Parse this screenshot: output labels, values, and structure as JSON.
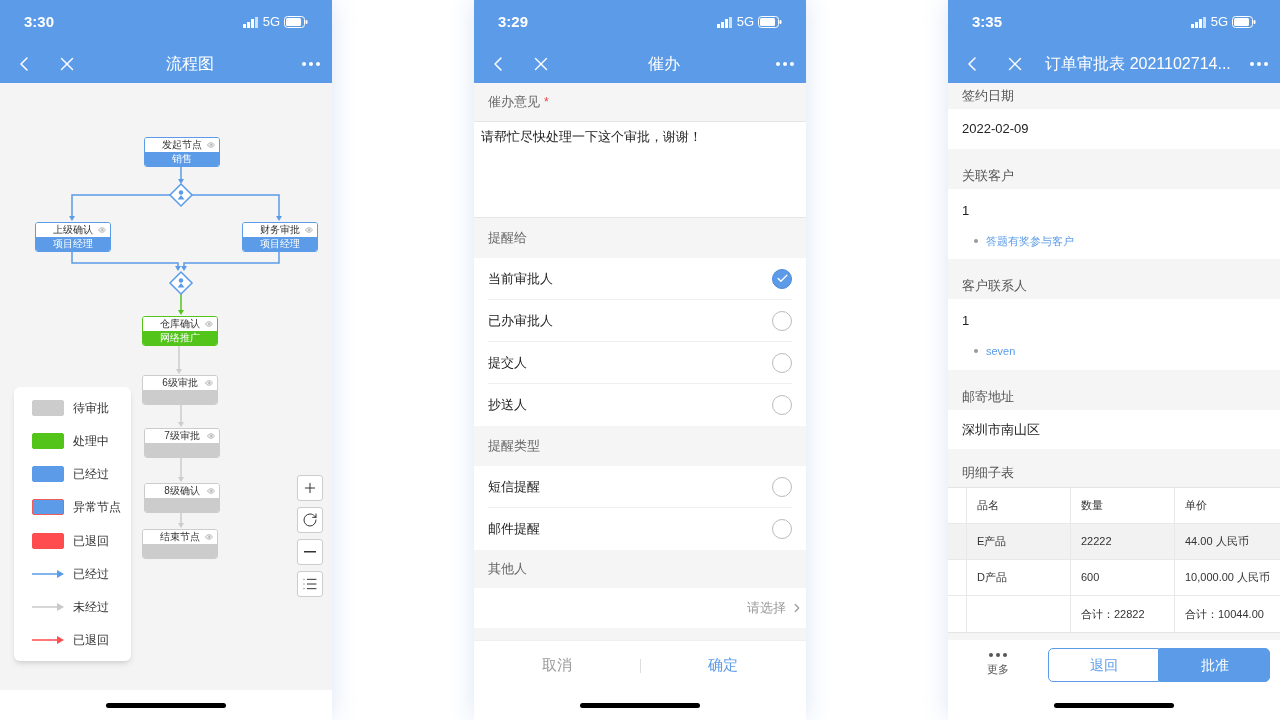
{
  "flowchart_screen": {
    "status_bar": {
      "time": "3:30",
      "network": "5G"
    },
    "nav": {
      "title": "流程图"
    },
    "nodes": [
      {
        "kind": "task",
        "title": "发起节点",
        "subtitle": "销售",
        "color": "#5b9be8"
      },
      {
        "kind": "gateway",
        "color": "#5b9be8"
      },
      {
        "kind": "task",
        "title": "上级确认",
        "subtitle": "项目经理",
        "color": "#5b9be8"
      },
      {
        "kind": "task",
        "title": "财务审批",
        "subtitle": "项目经理",
        "color": "#5b9be8"
      },
      {
        "kind": "gateway",
        "color": "#5b9be8"
      },
      {
        "kind": "task",
        "title": "仓库确认",
        "subtitle": "网络推广",
        "color": "#52c41a"
      },
      {
        "kind": "task",
        "title": "6级审批",
        "color": "#cccccc"
      },
      {
        "kind": "task",
        "title": "7级审批",
        "color": "#cccccc"
      },
      {
        "kind": "task",
        "title": "8级确认",
        "color": "#cccccc"
      },
      {
        "kind": "task",
        "title": "结束节点",
        "color": "#cccccc"
      }
    ],
    "legend": [
      {
        "kind": "swatch",
        "label": "待审批",
        "color": "#cccccc"
      },
      {
        "kind": "swatch",
        "label": "处理中",
        "color": "#52c41a"
      },
      {
        "kind": "swatch",
        "label": "已经过",
        "color": "#5b9be8"
      },
      {
        "kind": "outlined_swatch",
        "label": "异常节点",
        "color": "#5b9be8"
      },
      {
        "kind": "swatch",
        "label": "已退回",
        "color": "#ff4d4f"
      },
      {
        "kind": "arrow",
        "label": "已经过",
        "color": "#5b9be8"
      },
      {
        "kind": "arrow",
        "label": "未经过",
        "color": "#c8c8c8"
      },
      {
        "kind": "arrow",
        "label": "已退回",
        "color": "#ff4d4f"
      }
    ]
  },
  "urge_screen": {
    "status_bar": {
      "time": "3:29",
      "network": "5G"
    },
    "nav": {
      "title": "催办"
    },
    "opinion": {
      "label": "催办意见",
      "required_mark": "*",
      "value": "请帮忙尽快处理一下这个审批，谢谢！"
    },
    "groups": [
      {
        "title": "提醒给",
        "options": [
          {
            "label": "当前审批人",
            "selected": true
          },
          {
            "label": "已办审批人",
            "selected": false
          },
          {
            "label": "提交人",
            "selected": false
          },
          {
            "label": "抄送人",
            "selected": false
          }
        ]
      },
      {
        "title": "提醒类型",
        "options": [
          {
            "label": "短信提醒",
            "selected": false
          },
          {
            "label": "邮件提醒",
            "selected": false
          }
        ]
      }
    ],
    "other": {
      "title": "其他人",
      "placeholder": "请选择"
    },
    "footer": [
      {
        "label": "取消",
        "kind": "cancel"
      },
      {
        "label": "确定",
        "kind": "confirm"
      }
    ]
  },
  "order_screen": {
    "status_bar": {
      "time": "3:35",
      "network": "5G"
    },
    "nav": {
      "title": "订单审批表 2021102714..."
    },
    "fields": [
      {
        "label": "签约日期",
        "value": "2022-02-09"
      },
      {
        "label": "关联客户",
        "value": "1",
        "link": "答题有奖参与客户"
      },
      {
        "label": "客户联系人",
        "value": "1",
        "link": "seven"
      },
      {
        "label": "邮寄地址",
        "value": "深圳市南山区"
      }
    ],
    "table": {
      "title": "明细子表",
      "columns": [
        "品名",
        "数量",
        "单价"
      ],
      "rows": [
        [
          "E产品",
          "22222",
          "44.00 人民币"
        ],
        [
          "D产品",
          "600",
          "10,000.00 人民币"
        ],
        [
          "",
          "合计：22822",
          "合计：10044.00"
        ]
      ]
    },
    "footer": {
      "more": "更多",
      "buttons": [
        {
          "label": "退回",
          "kind": "outline"
        },
        {
          "label": "批准",
          "kind": "primary"
        }
      ]
    }
  }
}
